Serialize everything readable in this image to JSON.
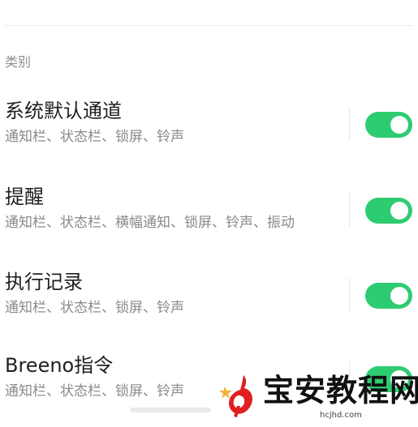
{
  "section": {
    "label": "类别"
  },
  "channels": [
    {
      "title": "系统默认通道",
      "subtitle": "通知栏、状态栏、锁屏、铃声",
      "enabled": true
    },
    {
      "title": "提醒",
      "subtitle": "通知栏、状态栏、横幅通知、锁屏、铃声、振动",
      "enabled": true
    },
    {
      "title": "执行记录",
      "subtitle": "通知栏、状态栏、锁屏、铃声",
      "enabled": true
    },
    {
      "title": "Breeno指令",
      "subtitle": "通知栏、状态栏、锁屏、铃声",
      "enabled": true
    }
  ],
  "watermark": {
    "text": "宝安教程网",
    "url": "hcjhd.com"
  },
  "colors": {
    "toggle_on": "#2ecc71",
    "title_text": "#1f1f1f",
    "subtitle_text": "#8a8a8a",
    "watermark_logo_red": "#e02020"
  },
  "icons": {
    "watermark_logo": "brand-logo-icon",
    "sparkle": "sparkle-icon"
  }
}
